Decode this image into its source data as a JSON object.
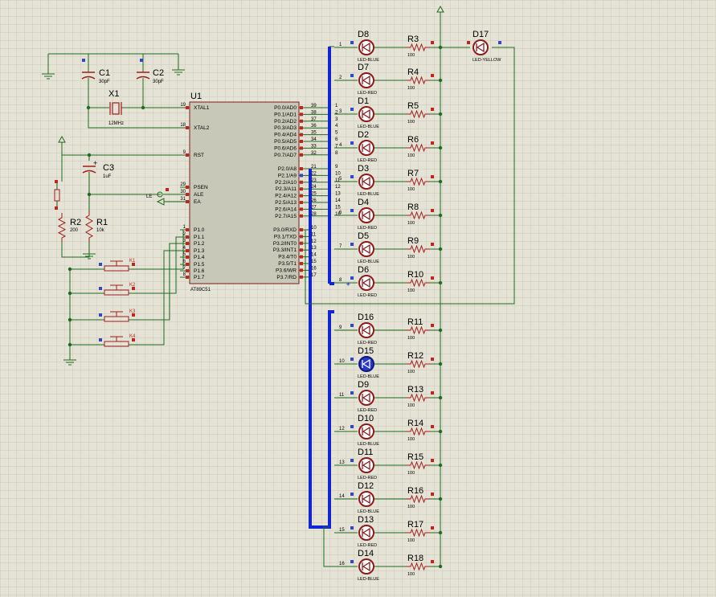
{
  "colors": {
    "background": "#e5e3d6",
    "grid": "#c9c8b8",
    "wire": "#1f6b1f",
    "bus": "#1026d4",
    "chip_fill": "#c8c8b8",
    "chip_border": "#7a1c1c",
    "pin_red": "#c0241c",
    "pin_blue": "#3048d0",
    "led_body": "#8b1a1a",
    "led_active": "#2838c8",
    "text": "#000000",
    "resistor": "#a01c1c"
  },
  "mcu": {
    "ref": "U1",
    "part": "AT89C51",
    "left_pins": [
      {
        "num": "19",
        "name": "XTAL1"
      },
      {
        "num": "18",
        "name": "XTAL2"
      },
      {
        "num": "9",
        "name": "RST"
      },
      {
        "num": "29",
        "name": "PSEN"
      },
      {
        "num": "30",
        "name": "ALE"
      },
      {
        "num": "31",
        "name": "EA"
      },
      {
        "num": "1",
        "name": "P1.0"
      },
      {
        "num": "2",
        "name": "P1.1"
      },
      {
        "num": "3",
        "name": "P1.2"
      },
      {
        "num": "4",
        "name": "P1.3"
      },
      {
        "num": "5",
        "name": "P1.4"
      },
      {
        "num": "6",
        "name": "P1.5"
      },
      {
        "num": "7",
        "name": "P1.6"
      },
      {
        "num": "8",
        "name": "P1.7"
      }
    ],
    "right_pins": [
      {
        "num": "39",
        "name": "P0.0/AD0",
        "net": "1"
      },
      {
        "num": "38",
        "name": "P0.1/AD1",
        "net": "2"
      },
      {
        "num": "37",
        "name": "P0.2/AD2",
        "net": "3"
      },
      {
        "num": "36",
        "name": "P0.3/AD3",
        "net": "4"
      },
      {
        "num": "35",
        "name": "P0.4/AD4",
        "net": "5"
      },
      {
        "num": "34",
        "name": "P0.5/AD5",
        "net": "6"
      },
      {
        "num": "33",
        "name": "P0.6/AD6",
        "net": "7"
      },
      {
        "num": "32",
        "name": "P0.7/AD7",
        "net": "8"
      },
      {
        "num": "21",
        "name": "P2.0/A8",
        "net": "9"
      },
      {
        "num": "22",
        "name": "P2.1/A9",
        "net": "10"
      },
      {
        "num": "23",
        "name": "P2.2/A10",
        "net": "11"
      },
      {
        "num": "24",
        "name": "P2.3/A11",
        "net": "12"
      },
      {
        "num": "25",
        "name": "P2.4/A12",
        "net": "13"
      },
      {
        "num": "26",
        "name": "P2.5/A13",
        "net": "14"
      },
      {
        "num": "27",
        "name": "P2.6/A14",
        "net": "15"
      },
      {
        "num": "28",
        "name": "P2.7/A15",
        "net": "16"
      },
      {
        "num": "10",
        "name": "P3.0/RXD",
        "net": ""
      },
      {
        "num": "11",
        "name": "P3.1/TXD",
        "net": ""
      },
      {
        "num": "12",
        "name": "P3.2/INT0",
        "net": ""
      },
      {
        "num": "13",
        "name": "P3.3/INT1",
        "net": ""
      },
      {
        "num": "14",
        "name": "P3.4/T0",
        "net": ""
      },
      {
        "num": "15",
        "name": "P3.5/T1",
        "net": ""
      },
      {
        "num": "16",
        "name": "P3.6/WR",
        "net": ""
      },
      {
        "num": "17",
        "name": "P3.7/RD",
        "net": ""
      }
    ]
  },
  "crystal": {
    "ref": "X1",
    "value": "12MHz"
  },
  "caps": [
    {
      "ref": "C1",
      "value": "30pF"
    },
    {
      "ref": "C2",
      "value": "30pF"
    },
    {
      "ref": "C3",
      "value": "1uF"
    }
  ],
  "reset_resistors": [
    {
      "ref": "R2",
      "value": "200"
    },
    {
      "ref": "R1",
      "value": "10k"
    }
  ],
  "le_label": "LE",
  "switches": [
    "K1",
    "K2",
    "K3",
    "K4"
  ],
  "leds_top": [
    {
      "ref": "D8",
      "type": "LED-BLUE",
      "net": "1",
      "res": "R3",
      "rval": "100"
    },
    {
      "ref": "D7",
      "type": "LED-RED",
      "net": "2",
      "res": "R4",
      "rval": "100"
    },
    {
      "ref": "D1",
      "type": "LED-BLUE",
      "net": "3",
      "res": "R5",
      "rval": "100"
    },
    {
      "ref": "D2",
      "type": "LED-RED",
      "net": "4",
      "res": "R6",
      "rval": "100"
    },
    {
      "ref": "D3",
      "type": "LED-BLUE",
      "net": "5",
      "res": "R7",
      "rval": "100"
    },
    {
      "ref": "D4",
      "type": "LED-RED",
      "net": "6",
      "res": "R8",
      "rval": "100"
    },
    {
      "ref": "D5",
      "type": "LED-BLUE",
      "net": "7",
      "res": "R9",
      "rval": "100"
    },
    {
      "ref": "D6",
      "type": "LED-RED",
      "net": "8",
      "res": "R10",
      "rval": "100"
    }
  ],
  "leds_bottom": [
    {
      "ref": "D16",
      "type": "LED-RED",
      "net": "9",
      "res": "R11",
      "rval": "100",
      "active": false
    },
    {
      "ref": "D15",
      "type": "LED-BLUE",
      "net": "10",
      "res": "R12",
      "rval": "100",
      "active": true
    },
    {
      "ref": "D9",
      "type": "LED-RED",
      "net": "11",
      "res": "R13",
      "rval": "100",
      "active": false
    },
    {
      "ref": "D10",
      "type": "LED-BLUE",
      "net": "12",
      "res": "R14",
      "rval": "100",
      "active": false
    },
    {
      "ref": "D11",
      "type": "LED-RED",
      "net": "13",
      "res": "R15",
      "rval": "100",
      "active": false
    },
    {
      "ref": "D12",
      "type": "LED-BLUE",
      "net": "14",
      "res": "R16",
      "rval": "100",
      "active": false
    },
    {
      "ref": "D13",
      "type": "LED-RED",
      "net": "15",
      "res": "R17",
      "rval": "100",
      "active": false
    },
    {
      "ref": "D14",
      "type": "LED-BLUE",
      "net": "16",
      "res": "R18",
      "rval": "100",
      "active": false
    }
  ],
  "extra_led": {
    "ref": "D17",
    "type": "LED-YELLOW"
  }
}
